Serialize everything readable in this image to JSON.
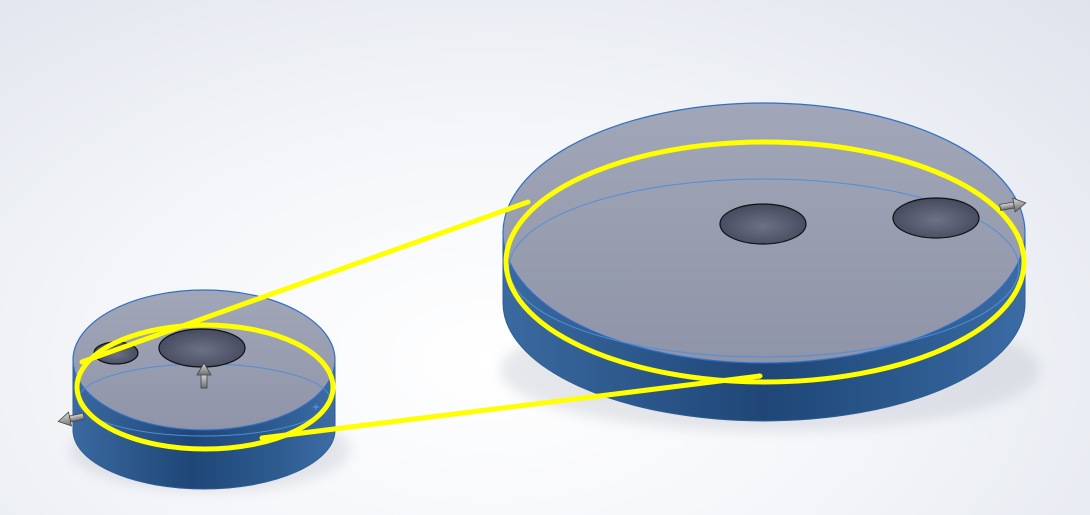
{
  "scene": {
    "background": "#eef0f5",
    "components": [
      {
        "name": "small-pulley",
        "face_color": "#9399ad",
        "side_color": "#2e5b8e",
        "holes": 2
      },
      {
        "name": "large-pulley",
        "face_color": "#9399ad",
        "side_color": "#2e5b8e",
        "holes": 2
      }
    ],
    "belt": {
      "color": "#ffff00",
      "selected": true
    },
    "drag_handles": [
      "left-arrow",
      "up-arrow",
      "right-arrow"
    ],
    "origin_markers": 2
  }
}
